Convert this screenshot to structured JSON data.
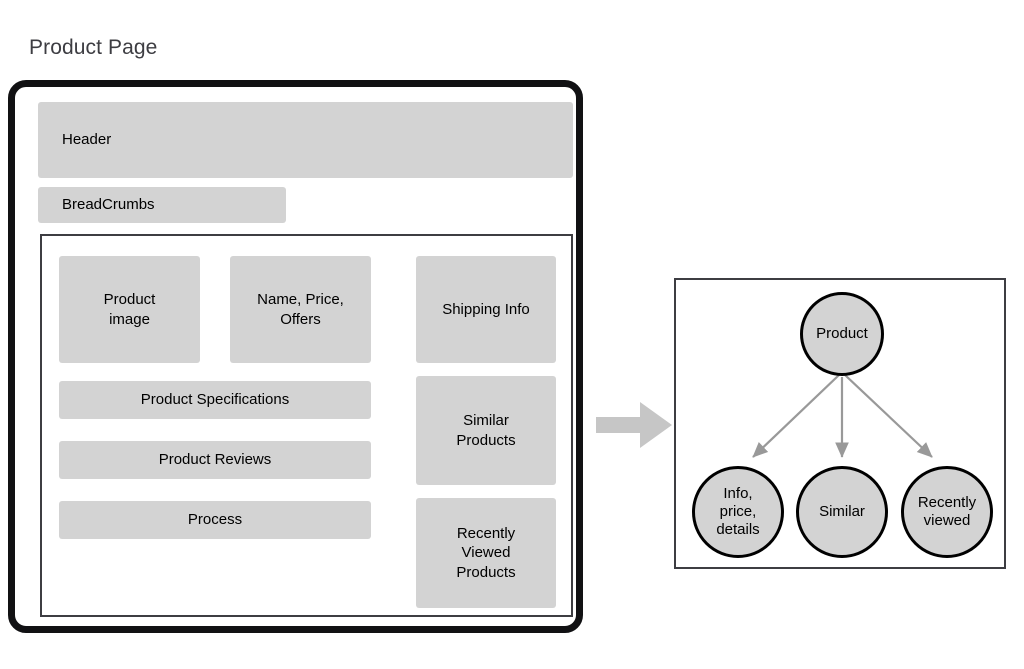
{
  "page_title": "Product Page",
  "mockup": {
    "header": {
      "label": "Header"
    },
    "breadcrumbs": {
      "label": "BreadCrumbs"
    },
    "content": {
      "product_image": "Product\nimage",
      "name_price_offers": "Name, Price,\nOffers",
      "shipping_info": "Shipping Info",
      "product_specifications": "Product Specifications",
      "product_reviews": "Product Reviews",
      "process": "Process",
      "similar_products": "Similar\nProducts",
      "recently_viewed_products": "Recently\nViewed\nProducts"
    }
  },
  "transform_arrow": {
    "icon": "right-block-arrow",
    "color": "#c6c6c6"
  },
  "graph": {
    "root": {
      "label": "Product"
    },
    "children": [
      {
        "label": "Info,\nprice,\ndetails"
      },
      {
        "label": "Similar"
      },
      {
        "label": "Recently\nviewed"
      }
    ],
    "edge_color": "#999999",
    "node_fill": "#d3d3d3",
    "node_stroke": "#000000"
  },
  "colors": {
    "block_fill": "#d3d3d3",
    "frame_black": "#111113",
    "panel_border": "#3d3d42",
    "title_text": "#3d3d42"
  }
}
